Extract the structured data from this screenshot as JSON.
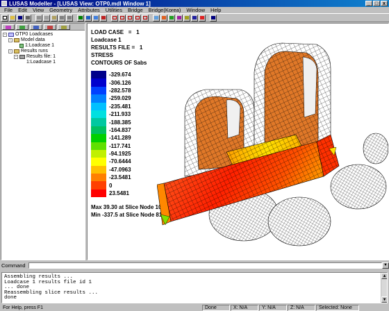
{
  "window": {
    "title": "LUSAS Modeller - [LUSAS View: OTP0.mdl Window 1]",
    "controls": [
      "_",
      "□",
      "x"
    ]
  },
  "menu": [
    "File",
    "Edit",
    "View",
    "Geometry",
    "Attributes",
    "Utilities",
    "Bridge",
    "Bridge(Korea)",
    "Window",
    "Help"
  ],
  "tree": {
    "root": "OTP0 Loadcases",
    "model_data": "Model data",
    "loadcase_model": "1:Loadcase 1",
    "results_runs": "Results runs",
    "results_file": "Results file: 1",
    "loadcase_results": "1:Loadcase 1"
  },
  "view": {
    "load_case_label": "LOAD CASE",
    "load_case_eq": "=",
    "load_case_value": "1",
    "load_case_name": "Loadcase 1",
    "results_file_label": "RESULTS FILE",
    "results_file_eq": "=",
    "results_file_value": "1",
    "stress_label": "STRESS",
    "contours_label": "CONTOURS OF Sabs",
    "max_text": "Max 39.30 at Slice Node 100696",
    "min_text": "Min -337.5 at Slice Node 81600"
  },
  "legend": [
    {
      "label": "-329.674",
      "color": "#00008b"
    },
    {
      "label": "-306.126",
      "color": "#0000cd"
    },
    {
      "label": "-282.578",
      "color": "#0040ff"
    },
    {
      "label": "-259.029",
      "color": "#0080ff"
    },
    {
      "label": "-235.481",
      "color": "#00c0ff"
    },
    {
      "label": "-211.933",
      "color": "#00e0e0"
    },
    {
      "label": "-188.385",
      "color": "#00c8a0"
    },
    {
      "label": "-164.837",
      "color": "#00c060"
    },
    {
      "label": "-141.289",
      "color": "#00d000"
    },
    {
      "label": "-117.741",
      "color": "#60e000"
    },
    {
      "label": "-94.1925",
      "color": "#c0f000"
    },
    {
      "label": "-70.6444",
      "color": "#ffff00"
    },
    {
      "label": "-47.0963",
      "color": "#ffc000"
    },
    {
      "label": "-23.5481",
      "color": "#ff8000"
    },
    {
      "label": "0",
      "color": "#ff4000"
    },
    {
      "label": "23.5481",
      "color": "#ff0000"
    }
  ],
  "command": {
    "label": "Command",
    "value": ""
  },
  "output": [
    "Assembling results ...",
    "Loadcase 1 results file id 1",
    "... done",
    "Reassembling slice results ...",
    "   done"
  ],
  "status": {
    "help": "For Help, press F1",
    "done": "Done",
    "x": "X: N/A",
    "y": "Y: N/A",
    "z": "Z: N/A",
    "selected": "Selected: None"
  }
}
